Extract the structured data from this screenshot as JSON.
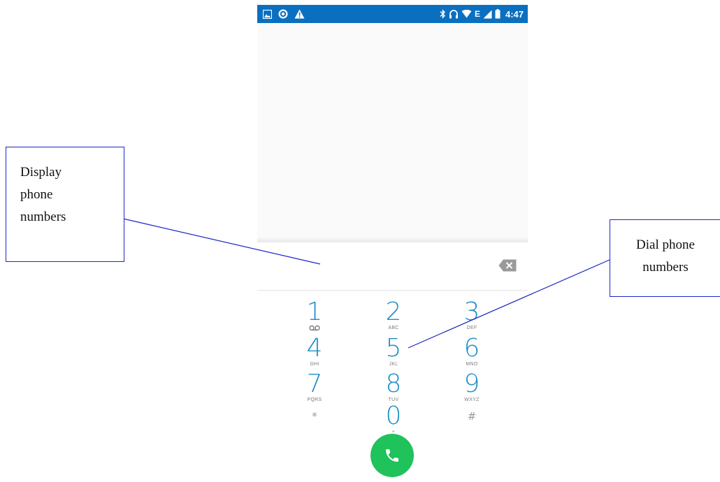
{
  "status_bar": {
    "time": "4:47",
    "network_type": "E",
    "left_icons": [
      "gallery-notification-icon",
      "app-notification-icon",
      "warning-icon"
    ],
    "right_icons": [
      "bluetooth-icon",
      "headset-icon",
      "wifi-icon",
      "cell-signal-icon",
      "battery-icon"
    ],
    "background_color": "#0b6fc0"
  },
  "dialer": {
    "digits_value": "",
    "keys": [
      {
        "digit": "1",
        "letters": "",
        "voicemail": true
      },
      {
        "digit": "2",
        "letters": "ABC"
      },
      {
        "digit": "3",
        "letters": "DEF"
      },
      {
        "digit": "4",
        "letters": "GHI"
      },
      {
        "digit": "5",
        "letters": "JKL"
      },
      {
        "digit": "6",
        "letters": "MNO"
      },
      {
        "digit": "7",
        "letters": "PQRS"
      },
      {
        "digit": "8",
        "letters": "TUV"
      },
      {
        "digit": "9",
        "letters": "WXYZ"
      },
      {
        "digit": "*",
        "letters": ""
      },
      {
        "digit": "0",
        "letters": "+"
      },
      {
        "digit": "#",
        "letters": ""
      }
    ],
    "digit_color": "#1f8ec6",
    "call_button_color": "#1fc25b"
  },
  "annotations": {
    "display_label": [
      "Display",
      "phone",
      "numbers"
    ],
    "dial_label": [
      "Dial phone",
      "numbers"
    ],
    "line_color": "#1a27c9"
  }
}
